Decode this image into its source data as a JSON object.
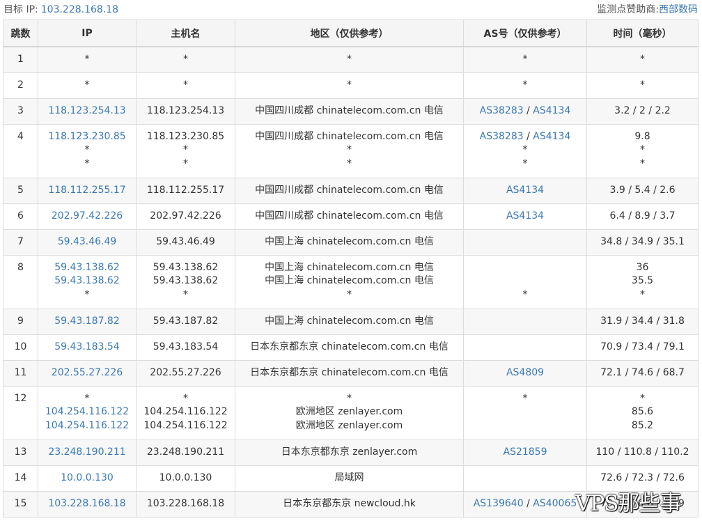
{
  "header": {
    "target_label": "目标 IP:",
    "target_ip": "103.228.168.18",
    "sponsor_label": "监测点赞助商:",
    "sponsor_name": "西部数码"
  },
  "columns": [
    "跳数",
    "IP",
    "主机名",
    "地区（仅供参考）",
    "AS号（仅供参考）",
    "时间（毫秒）"
  ],
  "rows": [
    {
      "hop": "1",
      "lines": [
        {
          "ip": "*",
          "host": "*",
          "region": "*",
          "as": [
            "*"
          ],
          "time": "*"
        }
      ],
      "h": 37
    },
    {
      "hop": "2",
      "lines": [
        {
          "ip": "*",
          "host": "*",
          "region": "*",
          "as": [
            "*"
          ],
          "time": "*"
        }
      ],
      "h": 37
    },
    {
      "hop": "3",
      "lines": [
        {
          "ip": "118.123.254.13",
          "host": "118.123.254.13",
          "region": "中国四川成都 chinatelecom.com.cn 电信",
          "as": [
            "AS38283",
            "AS4134"
          ],
          "time": "3.2 / 2 / 2.2"
        }
      ],
      "h": 37
    },
    {
      "hop": "4",
      "lines": [
        {
          "ip": "118.123.230.85",
          "host": "118.123.230.85",
          "region": "中国四川成都 chinatelecom.com.cn 电信",
          "as": [
            "AS38283",
            "AS4134"
          ],
          "time": "9.8"
        },
        {
          "ip": "*",
          "host": "*",
          "region": "*",
          "as": [
            "*"
          ],
          "time": "*"
        },
        {
          "ip": "*",
          "host": "*",
          "region": "*",
          "as": [
            "*"
          ],
          "time": "*"
        }
      ],
      "h": 77
    },
    {
      "hop": "5",
      "lines": [
        {
          "ip": "118.112.255.17",
          "host": "118.112.255.17",
          "region": "中国四川成都 chinatelecom.com.cn 电信",
          "as": [
            "AS4134"
          ],
          "time": "3.9 / 5.4 / 2.6"
        }
      ],
      "h": 37
    },
    {
      "hop": "6",
      "lines": [
        {
          "ip": "202.97.42.226",
          "host": "202.97.42.226",
          "region": "中国四川成都 chinatelecom.com.cn 电信",
          "as": [
            "AS4134"
          ],
          "time": "6.4 / 8.9 / 3.7"
        }
      ],
      "h": 37
    },
    {
      "hop": "7",
      "lines": [
        {
          "ip": "59.43.46.49",
          "host": "59.43.46.49",
          "region": "中国上海 chinatelecom.com.cn 电信",
          "as": [],
          "time": "34.8 / 34.9 / 35.1"
        }
      ],
      "h": 37
    },
    {
      "hop": "8",
      "lines": [
        {
          "ip": "59.43.138.62",
          "host": "59.43.138.62",
          "region": "中国上海 chinatelecom.com.cn 电信",
          "as": [],
          "time": "36"
        },
        {
          "ip": "59.43.138.62",
          "host": "59.43.138.62",
          "region": "中国上海 chinatelecom.com.cn 电信",
          "as": [],
          "time": "35.5"
        },
        {
          "ip": "*",
          "host": "*",
          "region": "*",
          "as": [
            "*"
          ],
          "time": "*"
        }
      ],
      "h": 77
    },
    {
      "hop": "9",
      "lines": [
        {
          "ip": "59.43.187.82",
          "host": "59.43.187.82",
          "region": "中国上海 chinatelecom.com.cn 电信",
          "as": [],
          "time": "31.9 / 34.4 / 31.8"
        }
      ],
      "h": 37
    },
    {
      "hop": "10",
      "lines": [
        {
          "ip": "59.43.183.54",
          "host": "59.43.183.54",
          "region": "日本东京都东京 chinatelecom.com.cn 电信",
          "as": [],
          "time": "70.9 / 73.4 / 79.1"
        }
      ],
      "h": 37
    },
    {
      "hop": "11",
      "lines": [
        {
          "ip": "202.55.27.226",
          "host": "202.55.27.226",
          "region": "日本东京都东京 chinatelecom.com.cn 电信",
          "as": [
            "AS4809"
          ],
          "time": "72.1 / 74.6 / 68.7"
        }
      ],
      "h": 37
    },
    {
      "hop": "12",
      "lines": [
        {
          "ip": "*",
          "host": "*",
          "region": "*",
          "as": [
            "*"
          ],
          "time": "*"
        },
        {
          "ip": "104.254.116.122",
          "host": "104.254.116.122",
          "region": "欧洲地区 zenlayer.com",
          "as": [],
          "time": "85.6"
        },
        {
          "ip": "104.254.116.122",
          "host": "104.254.116.122",
          "region": "欧洲地区 zenlayer.com",
          "as": [],
          "time": "85.2"
        }
      ],
      "h": 77
    },
    {
      "hop": "13",
      "lines": [
        {
          "ip": "23.248.190.211",
          "host": "23.248.190.211",
          "region": "日本东京都东京 zenlayer.com",
          "as": [
            "AS21859"
          ],
          "time": "110 / 110.8 / 110.2"
        }
      ],
      "h": 37
    },
    {
      "hop": "14",
      "lines": [
        {
          "ip": "10.0.0.130",
          "host": "10.0.0.130",
          "region": "局域网",
          "as": [],
          "time": "72.6 / 72.3 / 72.6"
        }
      ],
      "h": 37
    },
    {
      "hop": "15",
      "lines": [
        {
          "ip": "103.228.168.18",
          "host": "103.228.168.18",
          "region": "日本东京都东京 newcloud.hk",
          "as": [
            "AS139640",
            "AS40065"
          ],
          "time": "70.1 / 70.8 / 70.9"
        }
      ],
      "h": 37
    }
  ],
  "watermark": "VPS那些事"
}
